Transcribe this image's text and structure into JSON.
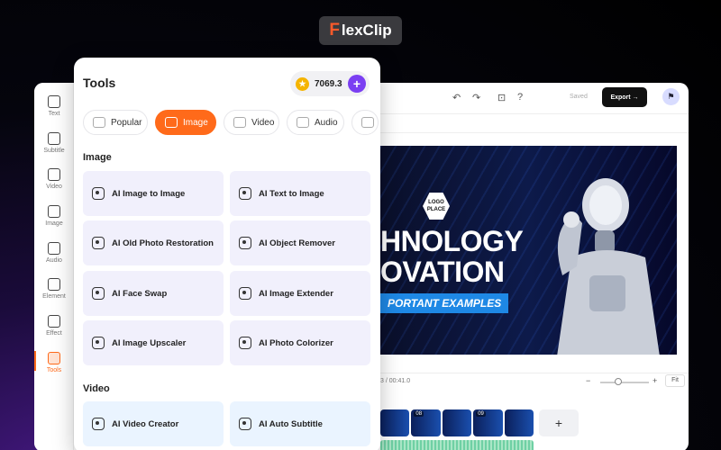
{
  "brand": {
    "name": "lexClip",
    "mark": "F"
  },
  "editor": {
    "sidebar": [
      {
        "label": "Text",
        "icon": "text-icon"
      },
      {
        "label": "Subtitle",
        "icon": "subtitle-icon"
      },
      {
        "label": "Video",
        "icon": "video-icon"
      },
      {
        "label": "Image",
        "icon": "image-icon"
      },
      {
        "label": "Audio",
        "icon": "audio-icon"
      },
      {
        "label": "Element",
        "icon": "element-icon"
      },
      {
        "label": "Effect",
        "icon": "effect-icon"
      },
      {
        "label": "Tools",
        "icon": "tools-icon"
      }
    ],
    "saved_label": "Saved",
    "export_label": "Export →",
    "time_display": "3 / 00:41.0",
    "fit_label": "Fit",
    "canvas": {
      "logo_text_1": "LOGO",
      "logo_text_2": "PLACE",
      "headline_1": "HNOLOGY",
      "headline_2": "OVATION",
      "subheadline": "PORTANT EXAMPLES"
    },
    "clips": [
      "",
      "08",
      "",
      "09",
      ""
    ],
    "add_clip_label": "+"
  },
  "tools": {
    "title": "Tools",
    "credits": "7069.3",
    "tabs": [
      {
        "label": "Popular",
        "active": false
      },
      {
        "label": "Image",
        "active": true
      },
      {
        "label": "Video",
        "active": false
      },
      {
        "label": "Audio",
        "active": false
      }
    ],
    "image_section": "Image",
    "image_items": [
      "AI Image to Image",
      "AI Text to Image",
      "AI Old Photo Restoration",
      "AI Object Remover",
      "AI Face Swap",
      "AI Image Extender",
      "AI Image Upscaler",
      "AI Photo Colorizer"
    ],
    "video_section": "Video",
    "video_items": [
      "AI Video Creator",
      "AI Auto Subtitle"
    ]
  },
  "colors": {
    "accent": "#ff6a1a",
    "credit_plus": "#7b3ff2",
    "card_bg": "#f1f0fc"
  }
}
